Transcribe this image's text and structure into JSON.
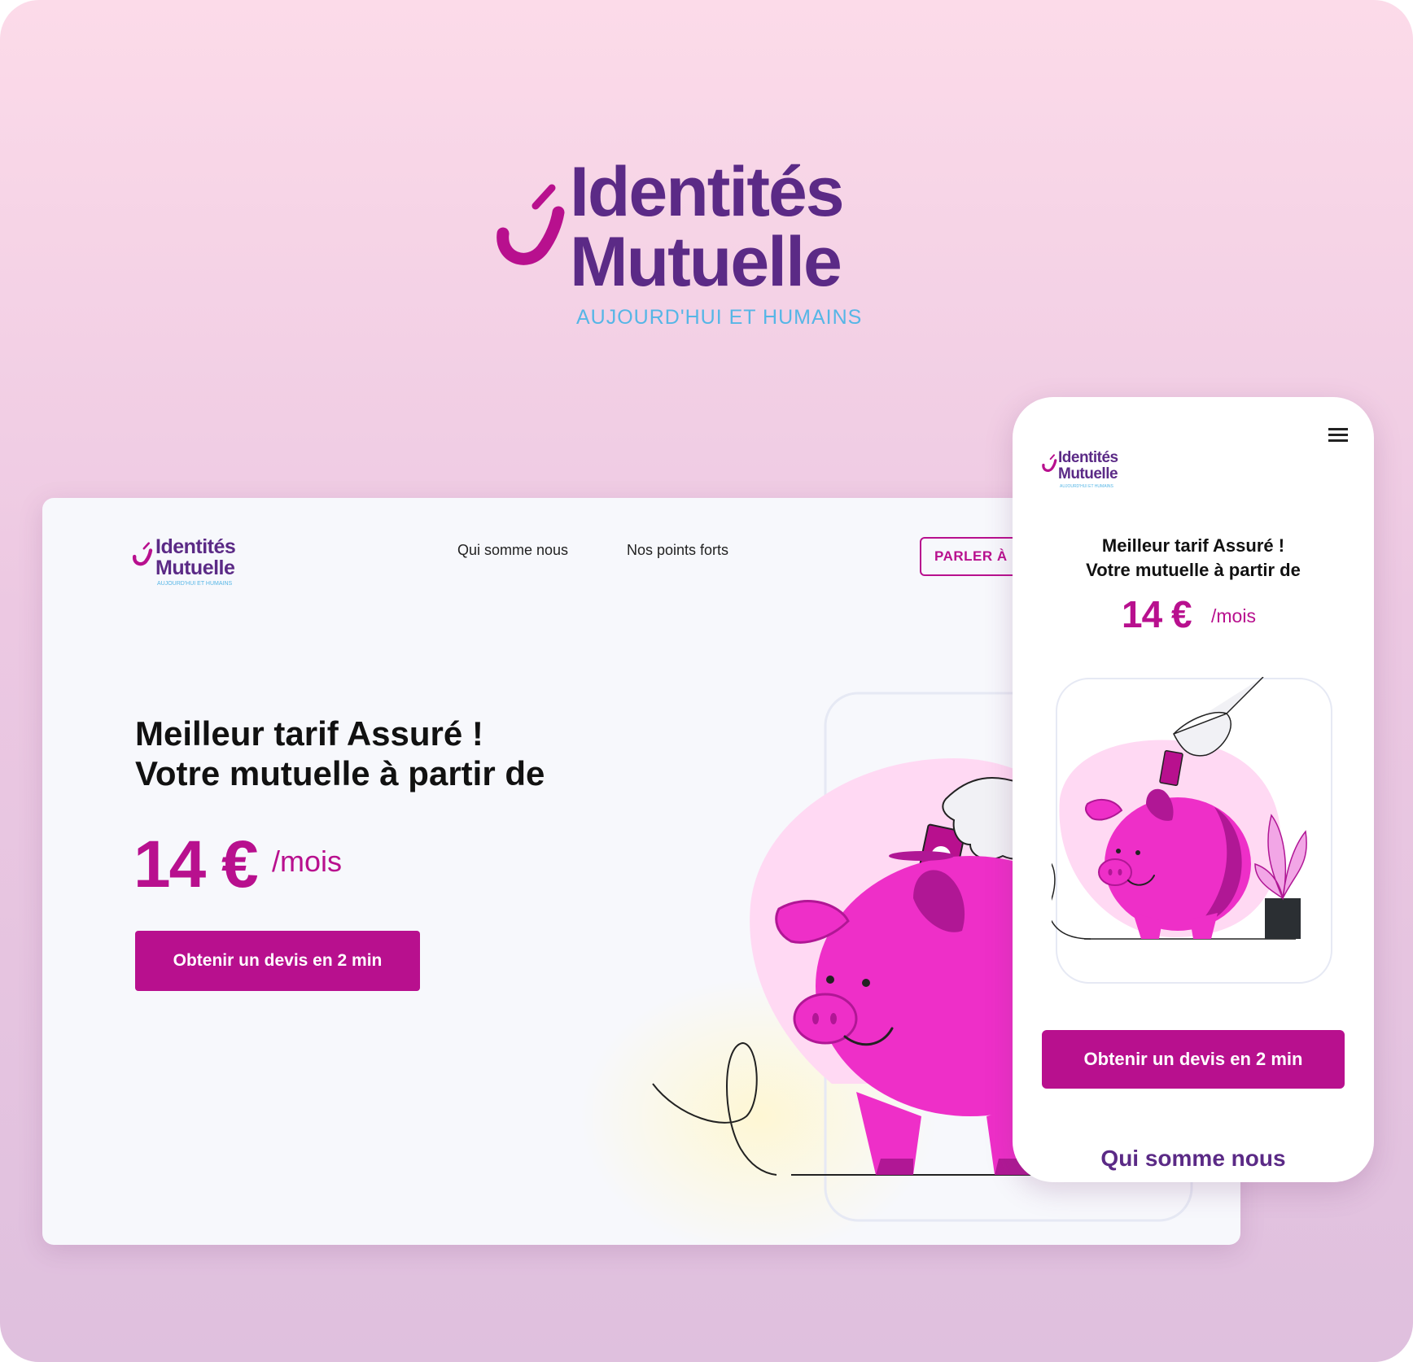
{
  "brand": {
    "name_line1": "Identités",
    "name_line2": "Mutuelle",
    "tagline": "AUJOURD'HUI ET HUMAINS",
    "primary_color": "#b8108e",
    "secondary_color": "#5b2a86",
    "accent_color": "#56b6e6"
  },
  "desktop": {
    "nav": {
      "items": [
        "Qui somme nous",
        "Nos points forts"
      ],
      "cta_label": "PARLER À"
    },
    "hero": {
      "line1": "Meilleur tarif Assuré !",
      "line2": "Votre mutuelle à partir de",
      "price": "14 €",
      "per": "/mois",
      "cta_label": "Obtenir un devis en 2 min"
    },
    "illustration": "piggy-bank-illustration"
  },
  "mobile": {
    "menu_icon": "hamburger-icon",
    "hero": {
      "line1": "Meilleur tarif Assuré !",
      "line2": "Votre mutuelle à partir de",
      "price": "14 €",
      "per": "/mois",
      "cta_label": "Obtenir un devis en 2 min"
    },
    "section_title": "Qui somme nous"
  }
}
